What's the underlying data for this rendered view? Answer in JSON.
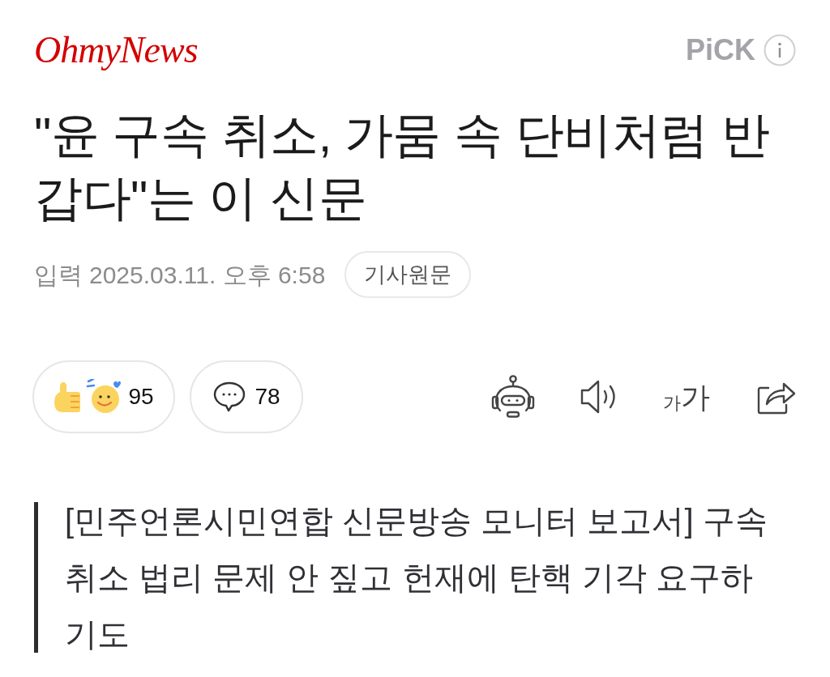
{
  "header": {
    "logo": "OhmyNews",
    "pick_label": "PiCK"
  },
  "headline": "\"윤 구속 취소, 가뭄 속 단비처럼 반갑다\"는 이 신문",
  "meta": {
    "label": "입력",
    "datetime": "2025.03.11. 오후 6:58",
    "source_button": "기사원문"
  },
  "actions": {
    "reaction_count": "95",
    "comment_count": "78",
    "font_size_button": {
      "small": "가",
      "large": "가"
    }
  },
  "summary": "[민주언론시민연합 신문방송 모니터 보고서] 구속 취소 법리 문제 안 짚고 헌재에 탄핵 기각 요구하기도"
}
